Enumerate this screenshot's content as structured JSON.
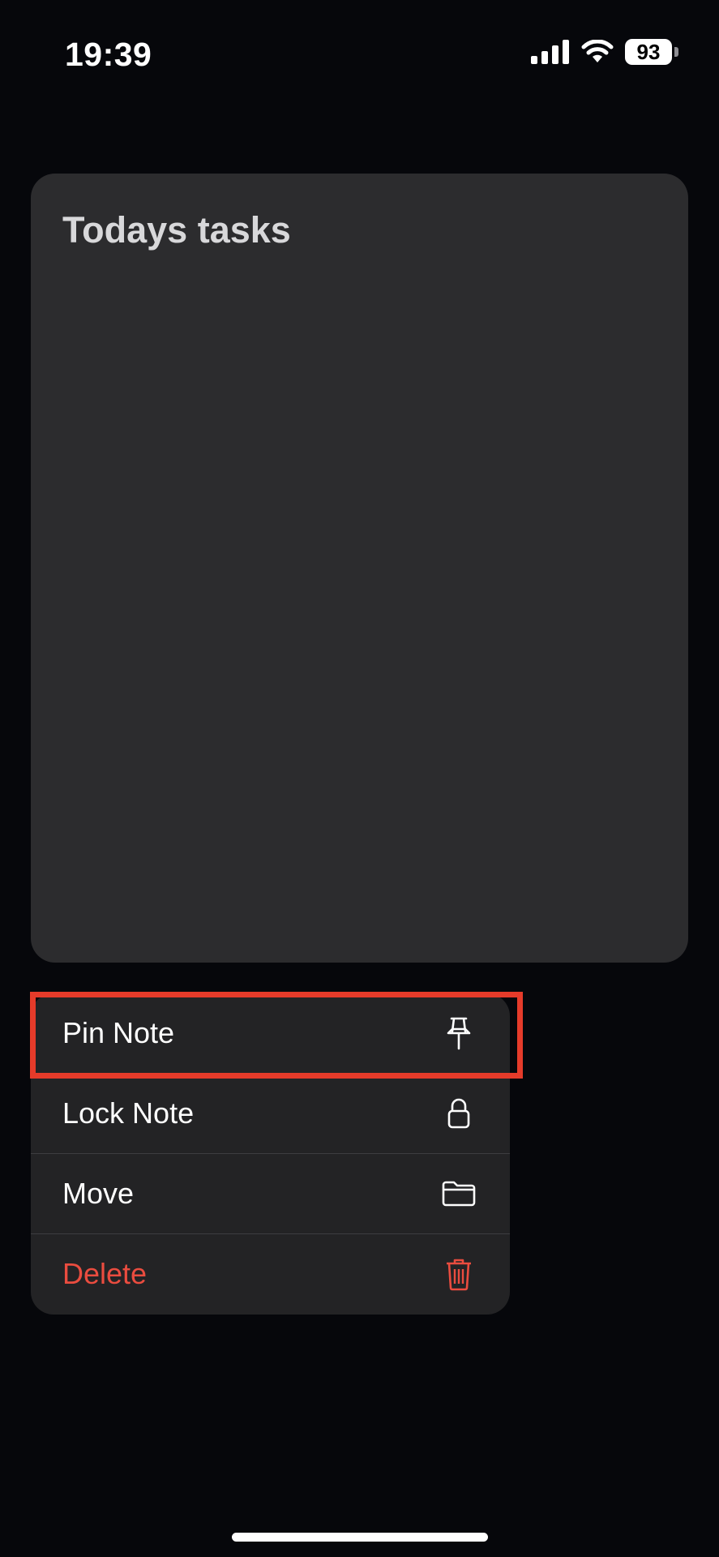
{
  "status_bar": {
    "time": "19:39",
    "battery_level": "93",
    "icons": [
      "signal-icon",
      "wifi-icon",
      "battery-icon"
    ]
  },
  "note": {
    "title": "Todays tasks"
  },
  "context_menu": {
    "items": [
      {
        "label": "Pin Note",
        "icon": "pin-icon",
        "highlighted": true
      },
      {
        "label": "Lock Note",
        "icon": "lock-icon"
      },
      {
        "label": "Move",
        "icon": "folder-icon"
      },
      {
        "label": "Delete",
        "icon": "trash-icon",
        "destructive": true
      }
    ]
  },
  "colors": {
    "background": "#06070b",
    "card": "#2c2c2e",
    "menu": "#232325",
    "destructive": "#ea4c3f",
    "highlight": "#e53b2a"
  }
}
